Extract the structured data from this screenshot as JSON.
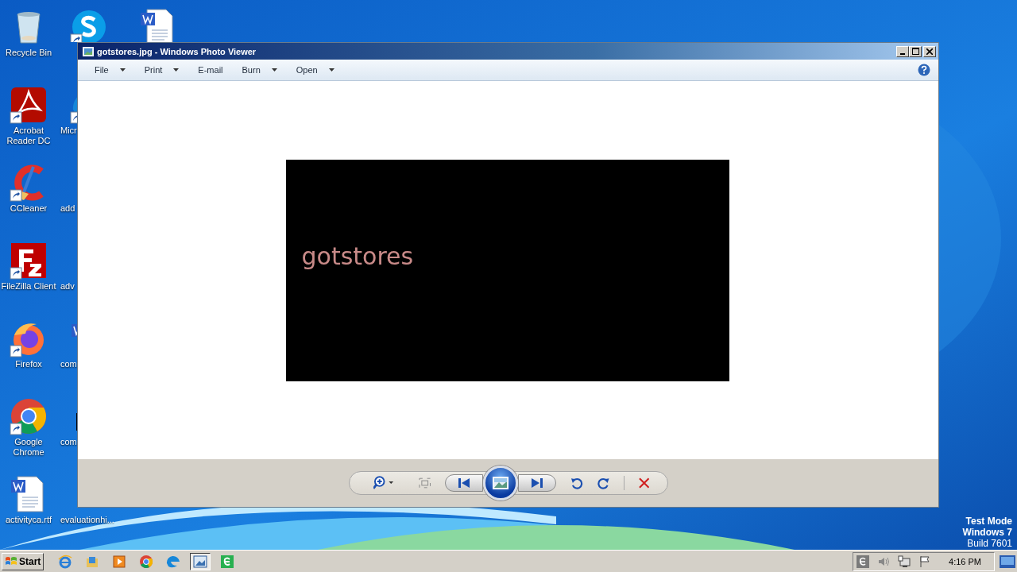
{
  "desktop": {
    "icon_columns": [
      [
        {
          "kind": "recycle",
          "label": "Recycle Bin",
          "shortcut": false
        },
        {
          "kind": "acrobat",
          "label": "Acrobat Reader DC",
          "shortcut": true
        },
        {
          "kind": "ccleaner",
          "label": "CCleaner",
          "shortcut": true
        },
        {
          "kind": "filezilla",
          "label": "FileZilla Client",
          "shortcut": true
        },
        {
          "kind": "firefox",
          "label": "Firefox",
          "shortcut": true
        },
        {
          "kind": "chrome",
          "label": "Google Chrome",
          "shortcut": true
        },
        {
          "kind": "word",
          "label": "activityca.rtf",
          "shortcut": false
        }
      ],
      [
        {
          "kind": "skype",
          "shortcut": true
        },
        {
          "kind": "edge",
          "label": "Micr",
          "shortcut": true
        },
        {
          "kind": "none",
          "label": "add"
        },
        {
          "kind": "none",
          "label": "adv"
        },
        {
          "kind": "word",
          "label": "com",
          "shortcut": false
        },
        {
          "kind": "black",
          "label": "com",
          "shortcut": false
        },
        {
          "kind": "none",
          "label": "evaluationhi..."
        }
      ],
      [
        {
          "kind": "word",
          "shortcut": false
        }
      ]
    ],
    "watermark_lines": [
      "Test Mode",
      "Windows 7",
      "Build 7601"
    ]
  },
  "window": {
    "title": "gotstores.jpg - Windows Photo Viewer",
    "menu": [
      {
        "label": "File",
        "dropdown": true
      },
      {
        "label": "Print",
        "dropdown": true
      },
      {
        "label": "E-mail",
        "dropdown": false
      },
      {
        "label": "Burn",
        "dropdown": true
      },
      {
        "label": "Open",
        "dropdown": true
      }
    ],
    "image_text": "gotstores"
  },
  "taskbar": {
    "start": "Start",
    "apps": [
      {
        "kind": "ie",
        "selected": false
      },
      {
        "kind": "folder",
        "selected": false
      },
      {
        "kind": "media",
        "selected": false
      },
      {
        "kind": "chrome",
        "selected": false
      },
      {
        "kind": "edge",
        "selected": false
      },
      {
        "kind": "viewer",
        "selected": true
      },
      {
        "kind": "green",
        "selected": false
      }
    ],
    "tray": [
      {
        "kind": "greenapp"
      },
      {
        "kind": "speaker"
      },
      {
        "kind": "network"
      },
      {
        "kind": "flag"
      }
    ],
    "clock": "4:16 PM"
  }
}
